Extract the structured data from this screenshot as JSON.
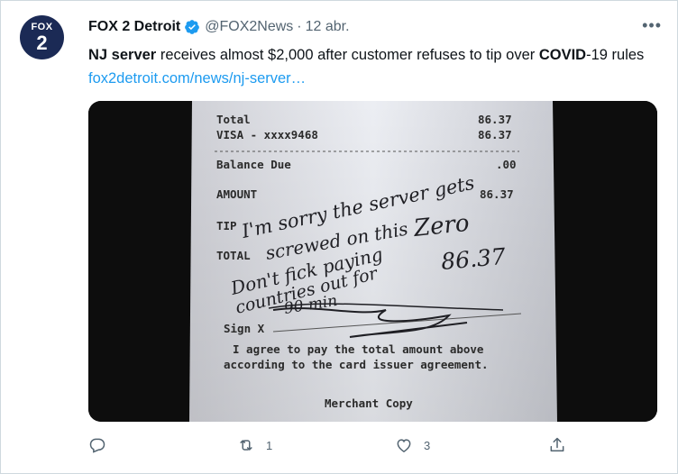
{
  "tweet": {
    "account_name": "FOX 2 Detroit",
    "handle": "@FOX2News",
    "separator": "·",
    "date": "12 abr.",
    "more_label": "•••",
    "avatar_line1": "FOX",
    "avatar_line2": "2",
    "text_parts": {
      "b1": "NJ server",
      "t1": " receives almost $2,000 after customer refuses to tip over ",
      "b2": "COVID",
      "t2": "-19 rules ",
      "link": "fox2detroit.com/news/nj-server…"
    }
  },
  "receipt": {
    "total_label": "Total",
    "total_value": "86.37",
    "visa_label": "VISA - xxxx9468",
    "visa_value": "86.37",
    "balance_label": "Balance Due",
    "balance_value": ".00",
    "amount_label": "AMOUNT",
    "amount_value": "86.37",
    "tip_label": "TIP",
    "total2_label": "TOTAL",
    "sign_label": "Sign X",
    "agree_line1": "I agree to pay the total amount above",
    "agree_line2": "according to the card issuer agreement.",
    "merchant_copy": "Merchant Copy",
    "hand_1": "I'm sorry the server gets",
    "hand_2": "screwed on this",
    "hand_zero": "Zero",
    "hand_3": "Don't fick paying",
    "hand_total": "86.37",
    "hand_4": "countries out for",
    "hand_5": "90 min"
  },
  "actions": {
    "reply_count": "",
    "retweet_count": "1",
    "like_count": "3",
    "share_count": ""
  },
  "colors": {
    "link": "#1d9bf0",
    "verified": "#1d9bf0",
    "muted": "#536471",
    "avatar_bg": "#1b2a55"
  }
}
